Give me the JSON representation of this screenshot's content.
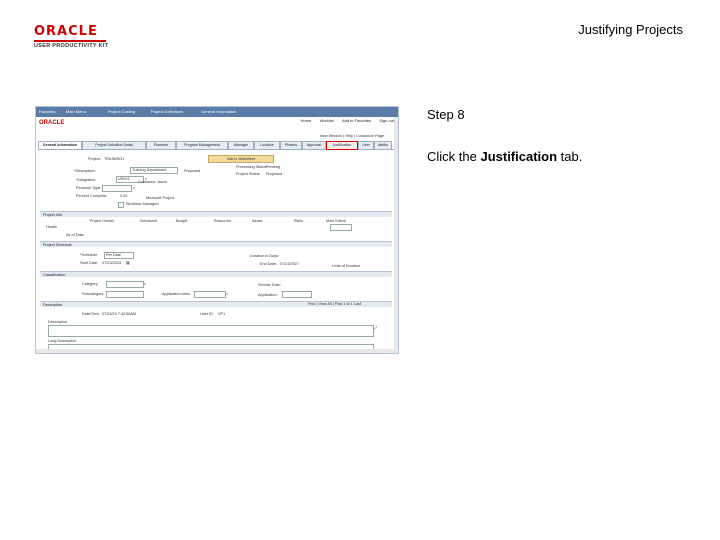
{
  "logo": {
    "brand": "ORACLE",
    "product": "USER PRODUCTIVITY KIT"
  },
  "header": {
    "title": "Justifying Projects"
  },
  "step": {
    "label": "Step 8"
  },
  "instruction": {
    "prefix": "Click the ",
    "bold": "Justification",
    "suffix": " tab."
  },
  "screenshot": {
    "topbar": [
      "Favorites",
      "Main Menu",
      "Project Costing",
      "Project Definitions",
      "General Information"
    ],
    "brand": "ORACLE",
    "nav_links": [
      "Home",
      "Worklist",
      "Add to Favorites",
      "Sign out"
    ],
    "subnav": "New Window | Help | Customize Page",
    "tabs": [
      "General Information",
      "Project Definition Detail",
      "Planners",
      "Program Management",
      "Manager",
      "Location",
      "Phases",
      "Approval",
      "Justification",
      "User",
      "Attribs"
    ],
    "fields": {
      "project_label": "Project:",
      "project_value": "TRAINING1",
      "add_button": "Add to Worksheet",
      "description_label": "*Description:",
      "description_value": "Training Department",
      "status_label": "Proposed",
      "integration_label": "*Integration:",
      "integration_value": "US001",
      "integration_desc": "Contractor Jason",
      "type_label": "Personal Type:",
      "percent_label": "Percent Complete:",
      "percent_value": "0.00",
      "ms_label": "Microsoft Project",
      "workflow_label": "Workflow Managed",
      "processing_label": "Processing Status",
      "funding_label": "Pending",
      "project_status_label": "Project Status",
      "status_value": "Proposed"
    },
    "sections": {
      "project_info": "Project Info",
      "project_schedule": "Project Schedule",
      "classification": "Classification",
      "description": "Description"
    },
    "info_columns": [
      "Project Overall",
      "Scheduled",
      "Budget",
      "Resources",
      "Issues",
      "Risks",
      "Most Critical"
    ],
    "info_row_label": "Health",
    "info_row_value": "As of Date",
    "schedule": {
      "schedule_label": "*Schedule",
      "schedule_value": "Per Date",
      "start_label": "Start Date:",
      "start_value": "07/23/2024",
      "duration_label": "Duration in Days:",
      "end_label": "End Date:",
      "end_value": "07/23/2027",
      "units_label": "Units of Duration"
    },
    "classification": {
      "category_label": "Category:",
      "subcat_label": "Subcategory:",
      "app_label": "Application Area:",
      "service_label": "Service Date:",
      "app_area_label": "Application:"
    },
    "description": {
      "nav": "Find | View All | First 1 of 1 Last",
      "datetime_label": "Date/Time",
      "datetime_value": "07/23/24  7:42:56AM",
      "user_label": "User ID",
      "user_value": "VP1",
      "desc_label": "Description",
      "long_label": "Long Description"
    }
  }
}
